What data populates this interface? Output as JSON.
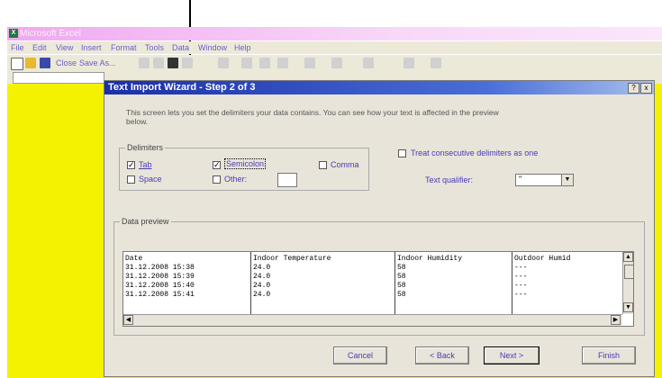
{
  "app": {
    "title": "Microsoft Excel",
    "icon": "excel-icon"
  },
  "menu": [
    "File",
    "Edit",
    "View",
    "Insert",
    "Format",
    "Tools",
    "Data",
    "Window",
    "Help"
  ],
  "toolbar": {
    "close_label": "Close",
    "saveas_label": "Save As..."
  },
  "dialog": {
    "title": "Text Import Wizard - Step 2 of 3",
    "help_label": "?",
    "close_label": "x",
    "intro": "This screen lets you set the delimiters your data contains.  You can see how your text is affected in the preview below.",
    "delimiters_label": "Delimiters",
    "tab_label": "Tab",
    "semicolon_label": "Semicolon",
    "comma_label": "Comma",
    "space_label": "Space",
    "other_label": "Other:",
    "consecutive_label": "Treat consecutive delimiters as one",
    "qualifier_label": "Text qualifier:",
    "qualifier_value": "\"",
    "preview_label": "Data preview",
    "preview_columns": [
      {
        "lines": "Date\n31.12.2008 15:38\n31.12.2008 15:39\n31.12.2008 15:40\n31.12.2008 15:41"
      },
      {
        "lines": "Indoor Temperature\n24.0\n24.0\n24.0\n24.0"
      },
      {
        "lines": "Indoor Humidity\n58\n58\n58\n58"
      },
      {
        "lines": "Outdoor Humid\n---\n---\n---\n---"
      }
    ],
    "buttons": {
      "cancel": "Cancel",
      "back": "< Back",
      "next": "Next >",
      "finish": "Finish"
    }
  },
  "colors": {
    "sheet_bg": "#f4f200",
    "title_bar": "#1a2fa8",
    "accent_text": "#4a3ab8"
  }
}
